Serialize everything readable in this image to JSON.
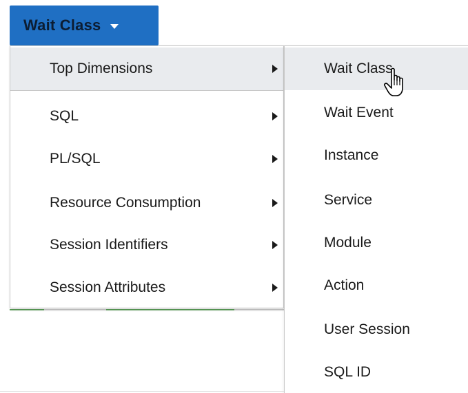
{
  "button": {
    "label": "Wait Class",
    "icon": "caret-down-icon",
    "color": "#1f6fc3"
  },
  "menu_level1": {
    "items": [
      {
        "label": "Top Dimensions",
        "active": true,
        "has_submenu": true
      },
      {
        "label": "SQL",
        "active": false,
        "has_submenu": true
      },
      {
        "label": "PL/SQL",
        "active": false,
        "has_submenu": true
      },
      {
        "label": "Resource Consumption",
        "active": false,
        "has_submenu": true
      },
      {
        "label": "Session Identifiers",
        "active": false,
        "has_submenu": true
      },
      {
        "label": "Session Attributes",
        "active": false,
        "has_submenu": true
      }
    ]
  },
  "menu_level2": {
    "items": [
      {
        "label": "Wait Class",
        "active": true
      },
      {
        "label": "Wait Event",
        "active": false
      },
      {
        "label": "Instance",
        "active": false
      },
      {
        "label": "Service",
        "active": false
      },
      {
        "label": "Module",
        "active": false
      },
      {
        "label": "Action",
        "active": false
      },
      {
        "label": "User Session",
        "active": false
      },
      {
        "label": "SQL ID",
        "active": false
      }
    ]
  },
  "cursor": {
    "icon": "hand-pointer-icon"
  },
  "colors": {
    "hover_background": "#e9ebee",
    "menu_border": "#c8c8c8"
  }
}
